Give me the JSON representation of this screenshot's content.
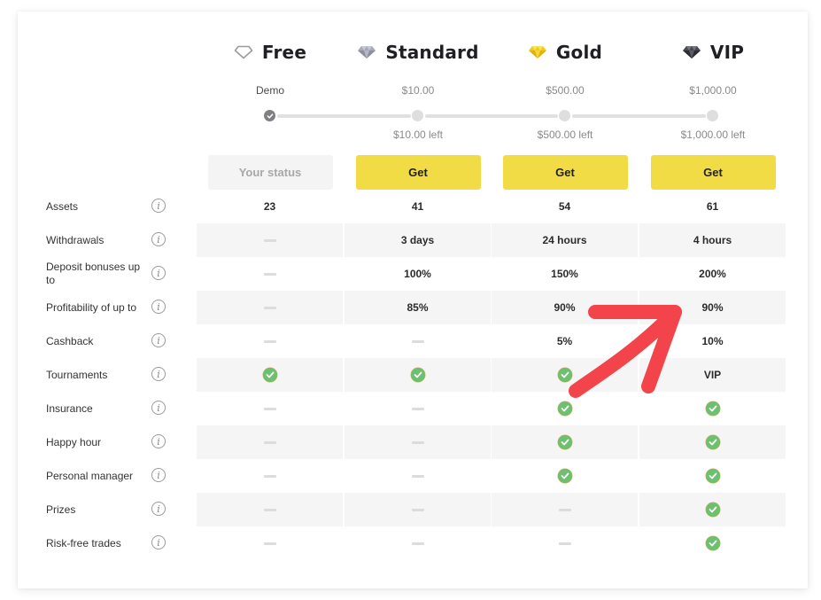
{
  "plans": [
    {
      "name": "Free",
      "icon": "diamond-outline-icon",
      "price": "Demo",
      "remaining": "",
      "action": "Your status",
      "current": true
    },
    {
      "name": "Standard",
      "icon": "diamond-silver-icon",
      "price": "$10.00",
      "remaining": "$10.00 left",
      "action": "Get",
      "current": false
    },
    {
      "name": "Gold",
      "icon": "diamond-gold-icon",
      "price": "$500.00",
      "remaining": "$500.00 left",
      "action": "Get",
      "current": false
    },
    {
      "name": "VIP",
      "icon": "diamond-black-icon",
      "price": "$1,000.00",
      "remaining": "$1,000.00 left",
      "action": "Get",
      "current": false
    }
  ],
  "colors": {
    "get_button": "#f2dc45",
    "check": "#6cc070",
    "annotation": "#f2444a",
    "row_shade": "#f5f5f5"
  },
  "features": [
    {
      "label": "Assets",
      "values": [
        "23",
        "41",
        "54",
        "61"
      ]
    },
    {
      "label": "Withdrawals",
      "values": [
        "-",
        "3 days",
        "24 hours",
        "4 hours"
      ]
    },
    {
      "label": "Deposit bonuses up to",
      "values": [
        "-",
        "100%",
        "150%",
        "200%"
      ]
    },
    {
      "label": "Profitability of up to",
      "values": [
        "-",
        "85%",
        "90%",
        "90%"
      ]
    },
    {
      "label": "Cashback",
      "values": [
        "-",
        "-",
        "5%",
        "10%"
      ]
    },
    {
      "label": "Tournaments",
      "values": [
        "check",
        "check",
        "check",
        "VIP"
      ]
    },
    {
      "label": "Insurance",
      "values": [
        "-",
        "-",
        "check",
        "check"
      ]
    },
    {
      "label": "Happy hour",
      "values": [
        "-",
        "-",
        "check",
        "check"
      ]
    },
    {
      "label": "Personal manager",
      "values": [
        "-",
        "-",
        "check",
        "check"
      ]
    },
    {
      "label": "Prizes",
      "values": [
        "-",
        "-",
        "-",
        "check"
      ]
    },
    {
      "label": "Risk-free trades",
      "values": [
        "-",
        "-",
        "-",
        "check"
      ]
    }
  ],
  "info_icon_glyph": "i",
  "annotation": {
    "type": "red-arrow",
    "points_to": "VIP profitability 90%"
  }
}
